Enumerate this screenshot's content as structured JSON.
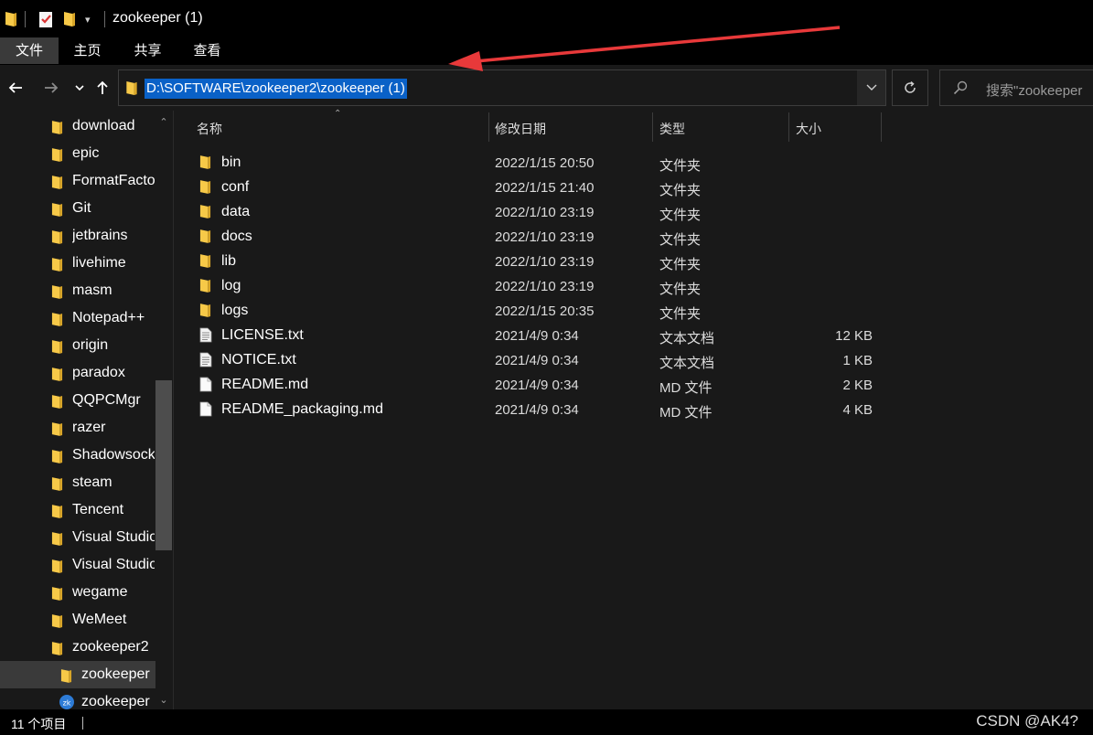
{
  "window": {
    "title": "zookeeper (1)"
  },
  "ribbon": {
    "tabs": [
      "文件",
      "主页",
      "共享",
      "查看"
    ],
    "active_tab": "文件"
  },
  "address_bar": {
    "path": "D:\\SOFTWARE\\zookeeper2\\zookeeper (1)"
  },
  "search": {
    "placeholder": "搜索\"zookeeper"
  },
  "sidebar": {
    "items": [
      {
        "label": "download"
      },
      {
        "label": "epic"
      },
      {
        "label": "FormatFactory"
      },
      {
        "label": "Git"
      },
      {
        "label": "jetbrains"
      },
      {
        "label": "livehime"
      },
      {
        "label": "masm"
      },
      {
        "label": "Notepad++"
      },
      {
        "label": "origin"
      },
      {
        "label": "paradox"
      },
      {
        "label": "QQPCMgr"
      },
      {
        "label": "razer"
      },
      {
        "label": "Shadowsocks"
      },
      {
        "label": "steam"
      },
      {
        "label": "Tencent"
      },
      {
        "label": "Visual Studio"
      },
      {
        "label": "Visual Studio"
      },
      {
        "label": "wegame"
      },
      {
        "label": "WeMeet"
      },
      {
        "label": "zookeeper2"
      },
      {
        "label": "zookeeper"
      },
      {
        "label": "zookeeper"
      }
    ],
    "selected_index": 20
  },
  "columns": {
    "name": "名称",
    "modified": "修改日期",
    "type": "类型",
    "size": "大小"
  },
  "files": [
    {
      "name": "bin",
      "modified": "2022/1/15 20:50",
      "type": "文件夹",
      "size": "",
      "icon": "folder"
    },
    {
      "name": "conf",
      "modified": "2022/1/15 21:40",
      "type": "文件夹",
      "size": "",
      "icon": "folder"
    },
    {
      "name": "data",
      "modified": "2022/1/10 23:19",
      "type": "文件夹",
      "size": "",
      "icon": "folder"
    },
    {
      "name": "docs",
      "modified": "2022/1/10 23:19",
      "type": "文件夹",
      "size": "",
      "icon": "folder"
    },
    {
      "name": "lib",
      "modified": "2022/1/10 23:19",
      "type": "文件夹",
      "size": "",
      "icon": "folder"
    },
    {
      "name": "log",
      "modified": "2022/1/10 23:19",
      "type": "文件夹",
      "size": "",
      "icon": "folder"
    },
    {
      "name": "logs",
      "modified": "2022/1/15 20:35",
      "type": "文件夹",
      "size": "",
      "icon": "folder"
    },
    {
      "name": "LICENSE.txt",
      "modified": "2021/4/9 0:34",
      "type": "文本文档",
      "size": "12 KB",
      "icon": "text-file"
    },
    {
      "name": "NOTICE.txt",
      "modified": "2021/4/9 0:34",
      "type": "文本文档",
      "size": "1 KB",
      "icon": "text-file"
    },
    {
      "name": "README.md",
      "modified": "2021/4/9 0:34",
      "type": "MD 文件",
      "size": "2 KB",
      "icon": "file"
    },
    {
      "name": "README_packaging.md",
      "modified": "2021/4/9 0:34",
      "type": "MD 文件",
      "size": "4 KB",
      "icon": "file"
    }
  ],
  "status": {
    "item_count": "11 个项目"
  },
  "watermark": "CSDN @AK4?",
  "colors": {
    "background": "#191919",
    "chrome": "#000000",
    "selection": "#0a61c7",
    "folder": "#f7c948",
    "annotation": "#e8393a"
  }
}
